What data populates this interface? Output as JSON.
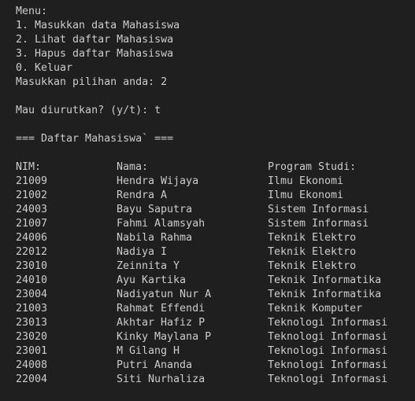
{
  "menu": {
    "title": "Menu:",
    "items": [
      "1. Masukkan data Mahasiswa",
      "2. Lihat daftar Mahasiswa",
      "3. Hapus daftar Mahasiswa",
      "0. Keluar"
    ],
    "prompt": "Masukkan pilihan anda: 2"
  },
  "sort_prompt": "Mau diurutkan? (y/t): t",
  "list_title": "=== Daftar Mahasiswa` ===",
  "table": {
    "headers": [
      "NIM:",
      "Nama:",
      "Program Studi:"
    ],
    "rows": [
      [
        "21009",
        "Hendra Wijaya",
        "Ilmu Ekonomi"
      ],
      [
        "21002",
        "Rendra A",
        "Ilmu Ekonomi"
      ],
      [
        "24003",
        "Bayu Saputra",
        "Sistem Informasi"
      ],
      [
        "21007",
        "Fahmi Alamsyah",
        "Sistem Informasi"
      ],
      [
        "24006",
        "Nabila Rahma",
        "Teknik Elektro"
      ],
      [
        "22012",
        "Nadiya I",
        "Teknik Elektro"
      ],
      [
        "23010",
        "Zeinnita Y",
        "Teknik Elektro"
      ],
      [
        "24010",
        "Ayu Kartika",
        "Teknik Informatika"
      ],
      [
        "23004",
        "Nadiyatun Nur A",
        "Teknik Informatika"
      ],
      [
        "21003",
        "Rahmat Effendi",
        "Teknik Komputer"
      ],
      [
        "23013",
        "Akhtar Hafiz P",
        "Teknologi Informasi"
      ],
      [
        "23020",
        "Kinky Maylana P",
        "Teknologi Informasi"
      ],
      [
        "23001",
        "M Gilang H",
        "Teknologi Informasi"
      ],
      [
        "24008",
        "Putri Ananda",
        "Teknologi Informasi"
      ],
      [
        "22004",
        "Siti Nurhaliza",
        "Teknologi Informasi"
      ]
    ]
  },
  "colors": {
    "background": "#1f1f1f",
    "text": "#cccccc"
  }
}
